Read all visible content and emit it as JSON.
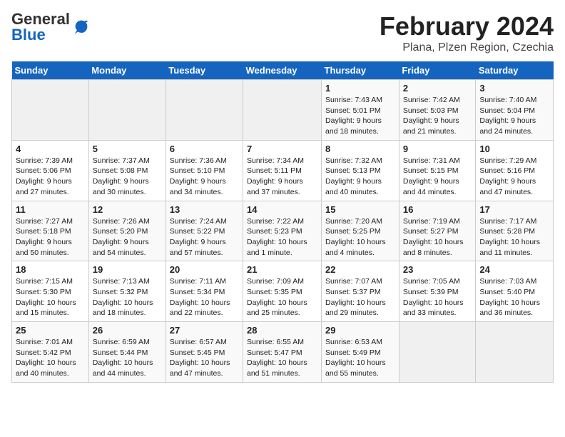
{
  "header": {
    "logo_general": "General",
    "logo_blue": "Blue",
    "title": "February 2024",
    "subtitle": "Plana, Plzen Region, Czechia"
  },
  "weekdays": [
    "Sunday",
    "Monday",
    "Tuesday",
    "Wednesday",
    "Thursday",
    "Friday",
    "Saturday"
  ],
  "weeks": [
    [
      {
        "day": "",
        "info": ""
      },
      {
        "day": "",
        "info": ""
      },
      {
        "day": "",
        "info": ""
      },
      {
        "day": "",
        "info": ""
      },
      {
        "day": "1",
        "info": "Sunrise: 7:43 AM\nSunset: 5:01 PM\nDaylight: 9 hours\nand 18 minutes."
      },
      {
        "day": "2",
        "info": "Sunrise: 7:42 AM\nSunset: 5:03 PM\nDaylight: 9 hours\nand 21 minutes."
      },
      {
        "day": "3",
        "info": "Sunrise: 7:40 AM\nSunset: 5:04 PM\nDaylight: 9 hours\nand 24 minutes."
      }
    ],
    [
      {
        "day": "4",
        "info": "Sunrise: 7:39 AM\nSunset: 5:06 PM\nDaylight: 9 hours\nand 27 minutes."
      },
      {
        "day": "5",
        "info": "Sunrise: 7:37 AM\nSunset: 5:08 PM\nDaylight: 9 hours\nand 30 minutes."
      },
      {
        "day": "6",
        "info": "Sunrise: 7:36 AM\nSunset: 5:10 PM\nDaylight: 9 hours\nand 34 minutes."
      },
      {
        "day": "7",
        "info": "Sunrise: 7:34 AM\nSunset: 5:11 PM\nDaylight: 9 hours\nand 37 minutes."
      },
      {
        "day": "8",
        "info": "Sunrise: 7:32 AM\nSunset: 5:13 PM\nDaylight: 9 hours\nand 40 minutes."
      },
      {
        "day": "9",
        "info": "Sunrise: 7:31 AM\nSunset: 5:15 PM\nDaylight: 9 hours\nand 44 minutes."
      },
      {
        "day": "10",
        "info": "Sunrise: 7:29 AM\nSunset: 5:16 PM\nDaylight: 9 hours\nand 47 minutes."
      }
    ],
    [
      {
        "day": "11",
        "info": "Sunrise: 7:27 AM\nSunset: 5:18 PM\nDaylight: 9 hours\nand 50 minutes."
      },
      {
        "day": "12",
        "info": "Sunrise: 7:26 AM\nSunset: 5:20 PM\nDaylight: 9 hours\nand 54 minutes."
      },
      {
        "day": "13",
        "info": "Sunrise: 7:24 AM\nSunset: 5:22 PM\nDaylight: 9 hours\nand 57 minutes."
      },
      {
        "day": "14",
        "info": "Sunrise: 7:22 AM\nSunset: 5:23 PM\nDaylight: 10 hours\nand 1 minute."
      },
      {
        "day": "15",
        "info": "Sunrise: 7:20 AM\nSunset: 5:25 PM\nDaylight: 10 hours\nand 4 minutes."
      },
      {
        "day": "16",
        "info": "Sunrise: 7:19 AM\nSunset: 5:27 PM\nDaylight: 10 hours\nand 8 minutes."
      },
      {
        "day": "17",
        "info": "Sunrise: 7:17 AM\nSunset: 5:28 PM\nDaylight: 10 hours\nand 11 minutes."
      }
    ],
    [
      {
        "day": "18",
        "info": "Sunrise: 7:15 AM\nSunset: 5:30 PM\nDaylight: 10 hours\nand 15 minutes."
      },
      {
        "day": "19",
        "info": "Sunrise: 7:13 AM\nSunset: 5:32 PM\nDaylight: 10 hours\nand 18 minutes."
      },
      {
        "day": "20",
        "info": "Sunrise: 7:11 AM\nSunset: 5:34 PM\nDaylight: 10 hours\nand 22 minutes."
      },
      {
        "day": "21",
        "info": "Sunrise: 7:09 AM\nSunset: 5:35 PM\nDaylight: 10 hours\nand 25 minutes."
      },
      {
        "day": "22",
        "info": "Sunrise: 7:07 AM\nSunset: 5:37 PM\nDaylight: 10 hours\nand 29 minutes."
      },
      {
        "day": "23",
        "info": "Sunrise: 7:05 AM\nSunset: 5:39 PM\nDaylight: 10 hours\nand 33 minutes."
      },
      {
        "day": "24",
        "info": "Sunrise: 7:03 AM\nSunset: 5:40 PM\nDaylight: 10 hours\nand 36 minutes."
      }
    ],
    [
      {
        "day": "25",
        "info": "Sunrise: 7:01 AM\nSunset: 5:42 PM\nDaylight: 10 hours\nand 40 minutes."
      },
      {
        "day": "26",
        "info": "Sunrise: 6:59 AM\nSunset: 5:44 PM\nDaylight: 10 hours\nand 44 minutes."
      },
      {
        "day": "27",
        "info": "Sunrise: 6:57 AM\nSunset: 5:45 PM\nDaylight: 10 hours\nand 47 minutes."
      },
      {
        "day": "28",
        "info": "Sunrise: 6:55 AM\nSunset: 5:47 PM\nDaylight: 10 hours\nand 51 minutes."
      },
      {
        "day": "29",
        "info": "Sunrise: 6:53 AM\nSunset: 5:49 PM\nDaylight: 10 hours\nand 55 minutes."
      },
      {
        "day": "",
        "info": ""
      },
      {
        "day": "",
        "info": ""
      }
    ]
  ]
}
